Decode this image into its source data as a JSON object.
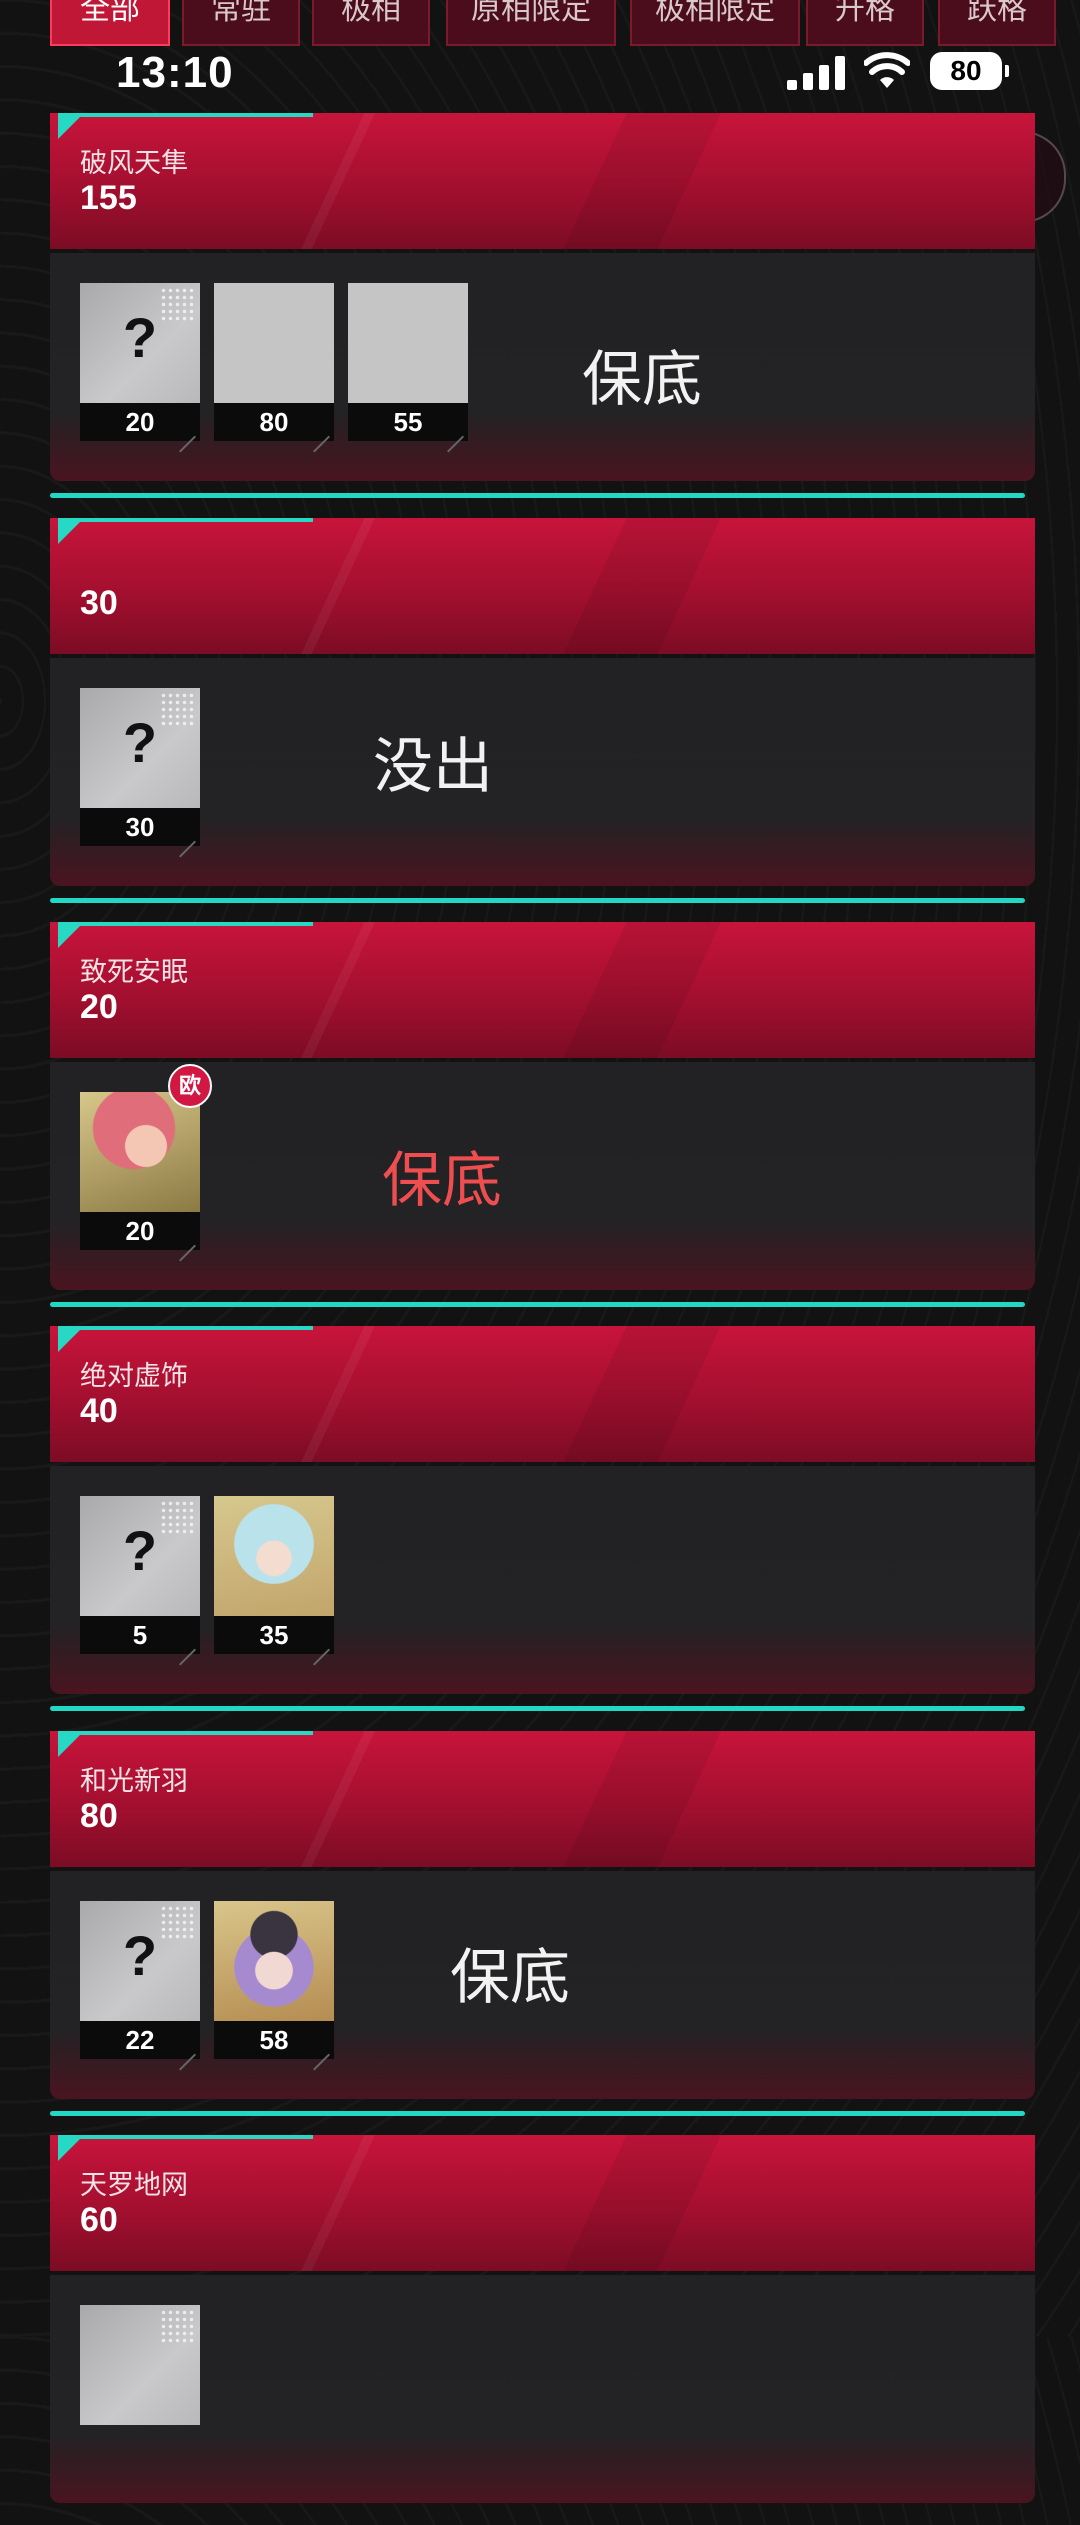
{
  "tabs": [
    {
      "label": "全部",
      "active": true
    },
    {
      "label": "常驻",
      "active": false
    },
    {
      "label": "极相",
      "active": false
    },
    {
      "label": "原相限定",
      "active": false
    },
    {
      "label": "极相限定",
      "active": false
    },
    {
      "label": "升格",
      "active": false
    },
    {
      "label": "跃格",
      "active": false
    }
  ],
  "status": {
    "time": "13:10",
    "battery": "80"
  },
  "cards": [
    {
      "title": "破风天隼",
      "count": "155",
      "remark": "保底",
      "remark_color": "#f2f2f2",
      "items": [
        {
          "type": "unknown",
          "value": "20"
        },
        {
          "type": "blank",
          "value": "80"
        },
        {
          "type": "blank",
          "value": "55"
        }
      ]
    },
    {
      "title": "",
      "count": "30",
      "remark": "没出",
      "remark_color": "#f2f2f2",
      "items": [
        {
          "type": "unknown",
          "value": "30"
        }
      ]
    },
    {
      "title": "致死安眠",
      "count": "20",
      "remark": "保底",
      "remark_color": "#ef4e51",
      "badge": "欧",
      "items": [
        {
          "type": "avatar-red",
          "value": "20"
        }
      ]
    },
    {
      "title": "绝对虚饰",
      "count": "40",
      "remark": "",
      "items": [
        {
          "type": "unknown",
          "value": "5"
        },
        {
          "type": "avatar-blue",
          "value": "35"
        }
      ]
    },
    {
      "title": "和光新羽",
      "count": "80",
      "remark": "保底",
      "remark_color": "#f2f2f2",
      "items": [
        {
          "type": "unknown",
          "value": "22"
        },
        {
          "type": "avatar-purple",
          "value": "58"
        }
      ]
    },
    {
      "title": "天罗地网",
      "count": "60",
      "remark": "",
      "items": []
    }
  ],
  "icons": {
    "unknown_mark": "?",
    "share": "share-icon",
    "record": "record-icon"
  }
}
